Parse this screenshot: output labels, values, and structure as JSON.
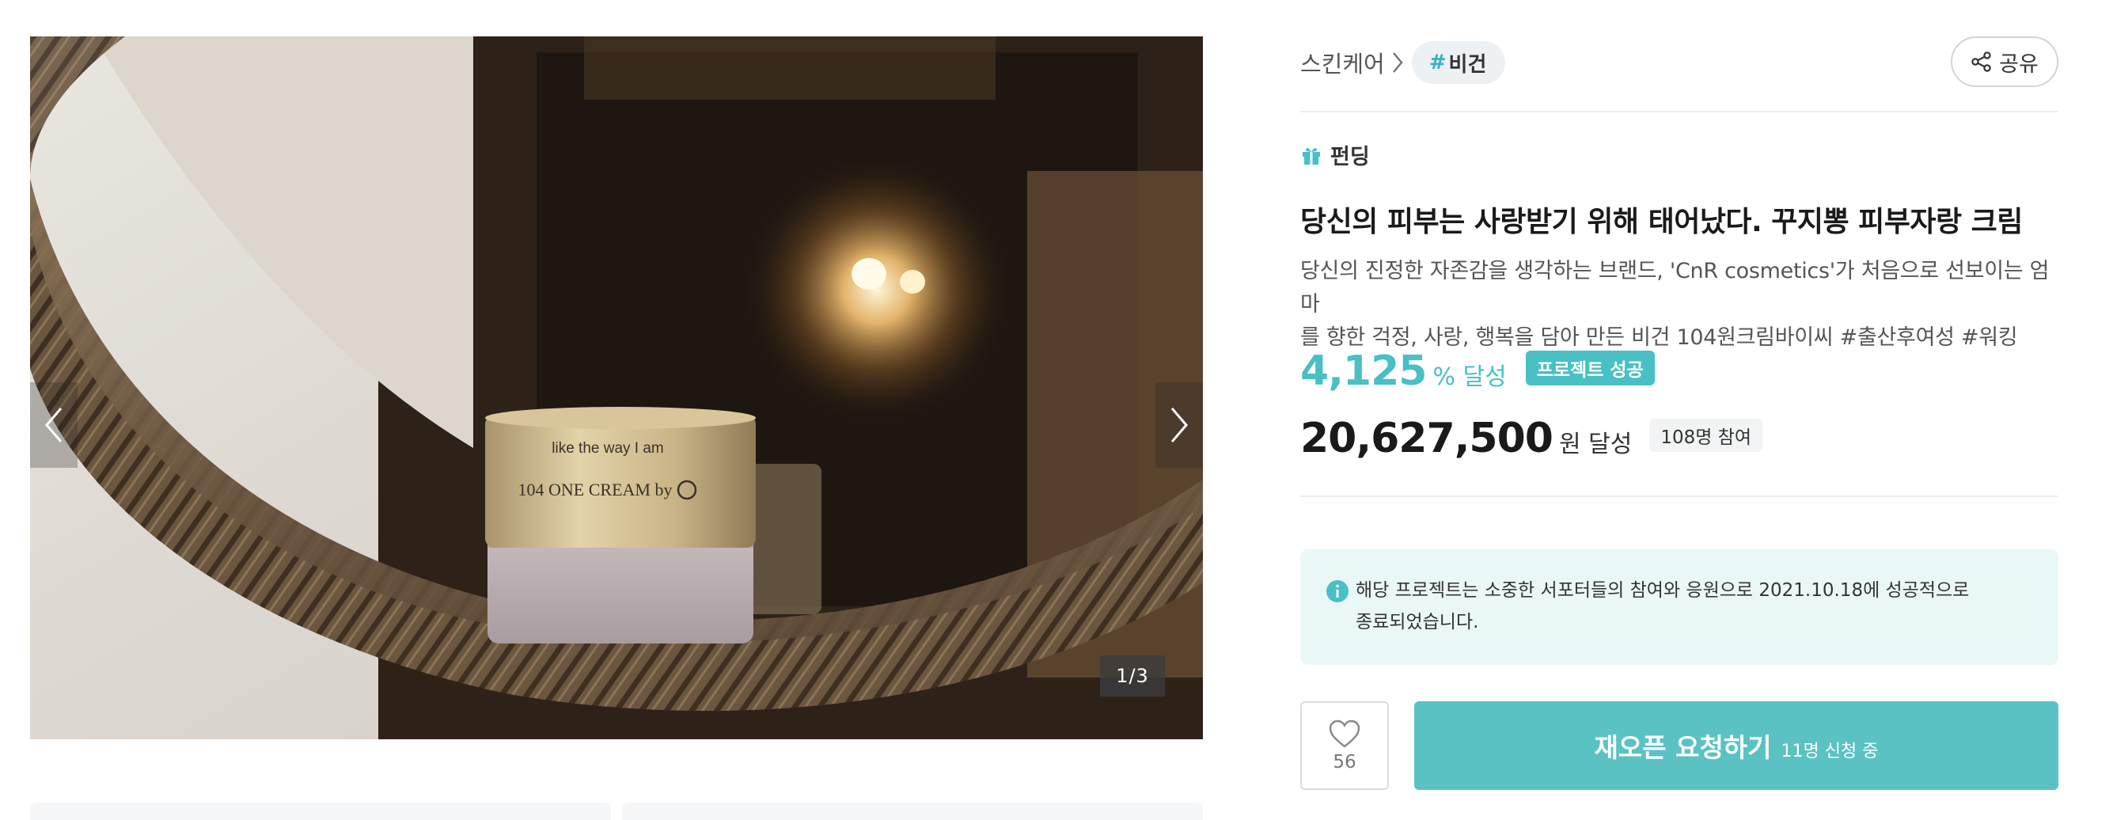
{
  "gallery": {
    "image_counter": "1/3",
    "product_print_line1": "like the way I am",
    "product_print_line2": "104 ONE CREAM by"
  },
  "breadcrumb": {
    "category": "스킨케어",
    "tag_hash": "#",
    "tag_label": "비건"
  },
  "share": {
    "label": "공유"
  },
  "project": {
    "type_label": "펀딩",
    "title": "당신의 피부는 사랑받기 위해 태어났다. 꾸지뽕 피부자랑 크림",
    "description_line1": "당신의 진정한 자존감을 생각하는 브랜드, 'CnR cosmetics'가 처음으로 선보이는 엄마",
    "description_line2": "를 향한 걱정, 사랑, 행복을 담아 만든 비건 104원크림바이씨 #출산후여성 #워킹"
  },
  "stats": {
    "achievement_rate": "4,125",
    "rate_unit": "% 달성",
    "status_badge": "프로젝트 성공",
    "amount": "20,627,500",
    "amount_unit": "원 달성",
    "supporters": "108명 참여"
  },
  "notice": {
    "line1": "해당 프로젝트는 소중한 서포터들의 참여와 응원으로 2021.10.18에 성공적으로",
    "line2": "종료되었습니다."
  },
  "actions": {
    "like_count": "56",
    "reopen_label": "재오픈 요청하기",
    "reopen_sub": "11명 신청 중"
  },
  "colors": {
    "accent": "#48c0c5",
    "button": "#5bc2c4",
    "notice_bg": "#eaf7f7"
  }
}
